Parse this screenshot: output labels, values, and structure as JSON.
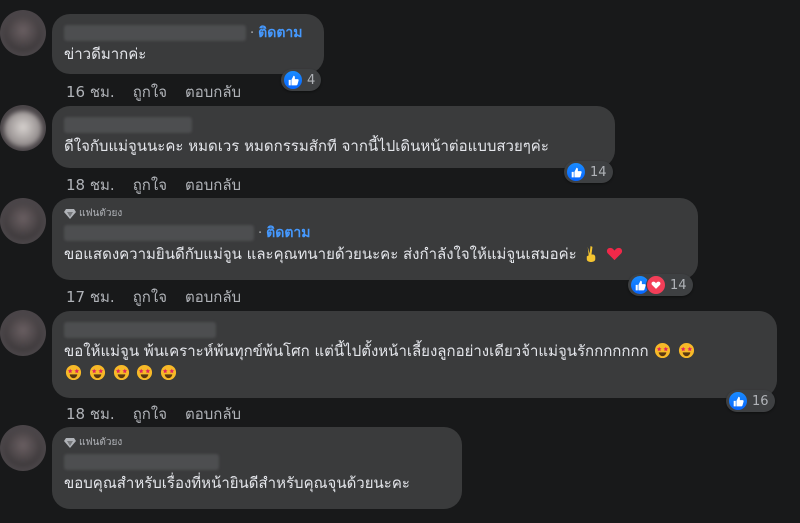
{
  "comments": [
    {
      "name_hidden": true,
      "follow_label": "ติดตาม",
      "text": "ข่าวดีมากค่ะ",
      "time": "16 ชม.",
      "like_label": "ถูกใจ",
      "reply_label": "ตอบกลับ",
      "reactions": {
        "types": [
          "like"
        ],
        "count": "4"
      }
    },
    {
      "name_hidden": true,
      "text": "ดีใจกับแม่จูนนะคะ หมดเวร หมดกรรมสักที จากนี้ไปเดินหน้าต่อแบบสวยๆค่ะ",
      "time": "18 ชม.",
      "like_label": "ถูกใจ",
      "reply_label": "ตอบกลับ",
      "reactions": {
        "types": [
          "like"
        ],
        "count": "14"
      }
    },
    {
      "badge": "แฟนตัวยง",
      "name_hidden": true,
      "follow_label": "ติดตาม",
      "text": "ขอแสดงความยินดีกับแม่จูน และคุณทนายด้วยนะคะ ส่งกำลังใจให้แม่จูนเสมอค่ะ",
      "emoji_suffix": [
        "victory-hand-emoji",
        "red-heart-emoji"
      ],
      "time": "17 ชม.",
      "like_label": "ถูกใจ",
      "reply_label": "ตอบกลับ",
      "reactions": {
        "types": [
          "like",
          "love"
        ],
        "count": "14"
      }
    },
    {
      "name_hidden": true,
      "text": "ขอให้แม่จูน พ้นเคราะห์พ้นทุกข์พ้นโศก แต่นี้ไปตั้งหน้าเลี้ยงลูกอย่างเดียวจ้าแม่จูนรักกกกกกก",
      "emoji_suffix": [
        "star-struck-emoji",
        "star-struck-emoji"
      ],
      "second_line_emoji": [
        "star-struck-emoji",
        "star-struck-emoji",
        "star-struck-emoji",
        "star-struck-emoji",
        "star-struck-emoji"
      ],
      "time": "18 ชม.",
      "like_label": "ถูกใจ",
      "reply_label": "ตอบกลับ",
      "reactions": {
        "types": [
          "like"
        ],
        "count": "16"
      }
    },
    {
      "badge": "แฟนตัวยง",
      "name_hidden": true,
      "text": "ขอบคุณสำหรับเรื่องที่หน้ายินดีสำหรับคุณจุนด้วยนะคะ"
    }
  ],
  "colors": {
    "background": "#18191a",
    "bubble": "#3a3b3c",
    "link": "#4599ff",
    "like": "#0866ff",
    "love": "#f33e58"
  }
}
